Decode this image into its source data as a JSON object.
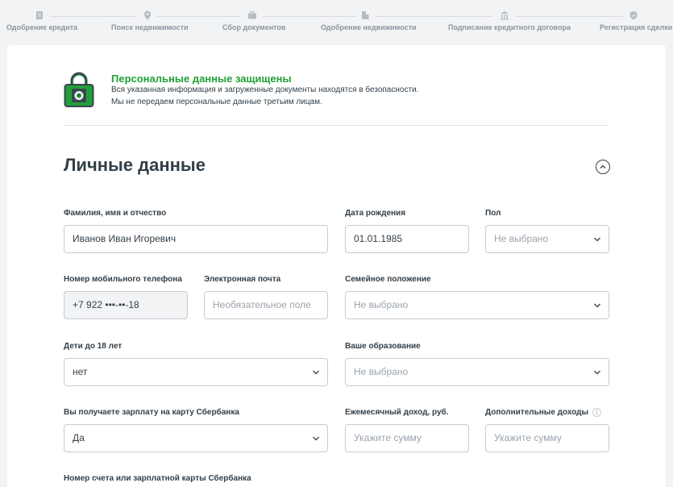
{
  "stepper": {
    "steps": [
      {
        "label": "Одобрение кредита",
        "icon": "document-icon"
      },
      {
        "label": "Поиск недвижимости",
        "icon": "map-pin-icon"
      },
      {
        "label": "Сбор документов",
        "icon": "briefcase-icon"
      },
      {
        "label": "Одобрение недвижимости",
        "icon": "building-icon"
      },
      {
        "label": "Подписание кредитного договора",
        "icon": "bank-icon"
      },
      {
        "label": "Регистрация сделки",
        "icon": "shield-icon"
      }
    ]
  },
  "security": {
    "title": "Персональные данные защищены",
    "line1": "Вся указанная информация и загруженные документы находятся в безопасности.",
    "line2": "Мы не передаем персональные данные третьим лицам.",
    "color": "#21a038"
  },
  "section": {
    "title": "Личные данные"
  },
  "form": {
    "full_name": {
      "label": "Фамилия, имя и отчество",
      "value": "Иванов Иван Игоревич"
    },
    "birth_date": {
      "label": "Дата рождения",
      "value": "01.01.1985"
    },
    "gender": {
      "label": "Пол",
      "value": "Не выбрано"
    },
    "phone": {
      "label": "Номер мобильного телефона",
      "value": "+7 922 •••-••-18"
    },
    "email": {
      "label": "Электронная почта",
      "placeholder": "Необязательное поле"
    },
    "marital": {
      "label": "Семейное положение",
      "value": "Не выбрано"
    },
    "children": {
      "label": "Дети до 18 лет",
      "value": "нет"
    },
    "education": {
      "label": "Ваше образование",
      "value": "Не выбрано"
    },
    "salary_card": {
      "label": "Вы получаете зарплату на карту Сбербанка",
      "value": "Да"
    },
    "monthly_income": {
      "label": "Ежемесячный доход, руб.",
      "placeholder": "Укажите сумму"
    },
    "extra_income": {
      "label": "Дополнительные доходы",
      "placeholder": "Укажите сумму",
      "info": "i"
    },
    "account": {
      "label": "Номер счета или зарплатной карты Сбербанка"
    }
  }
}
